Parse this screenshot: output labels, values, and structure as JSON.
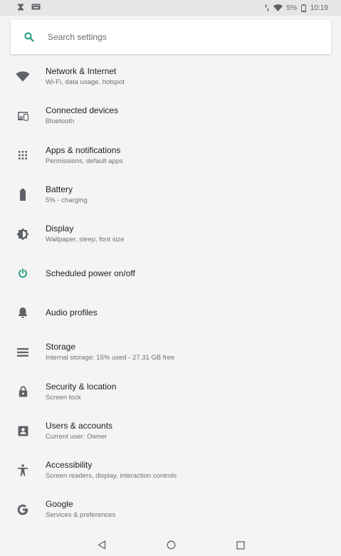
{
  "status_bar": {
    "battery_percent": "5%",
    "time": "10:19"
  },
  "search": {
    "placeholder": "Search settings"
  },
  "settings": [
    {
      "title": "Network & Internet",
      "summary": "Wi-Fi, data usage, hotspot",
      "icon": "wifi-icon"
    },
    {
      "title": "Connected devices",
      "summary": "Bluetooth",
      "icon": "devices-icon"
    },
    {
      "title": "Apps & notifications",
      "summary": "Permissions, default apps",
      "icon": "apps-grid-icon"
    },
    {
      "title": "Battery",
      "summary": "5% - charging",
      "icon": "battery-icon"
    },
    {
      "title": "Display",
      "summary": "Wallpaper, sleep, font size",
      "icon": "brightness-icon"
    },
    {
      "title": "Scheduled power on/off",
      "summary": "",
      "icon": "power-icon"
    },
    {
      "title": "Audio profiles",
      "summary": "",
      "icon": "bell-icon"
    },
    {
      "title": "Storage",
      "summary": "Internal storage: 15% used - 27.31 GB free",
      "icon": "storage-icon"
    },
    {
      "title": "Security & location",
      "summary": "Screen lock",
      "icon": "lock-icon"
    },
    {
      "title": "Users & accounts",
      "summary": "Current user: Owner",
      "icon": "account-icon"
    },
    {
      "title": "Accessibility",
      "summary": "Screen readers, display, interaction controls",
      "icon": "accessibility-icon"
    },
    {
      "title": "Google",
      "summary": "Services & preferences",
      "icon": "google-icon"
    }
  ],
  "colors": {
    "accent": "#1a9b7b",
    "icon": "#5f6368",
    "background": "#f4f4f5"
  }
}
